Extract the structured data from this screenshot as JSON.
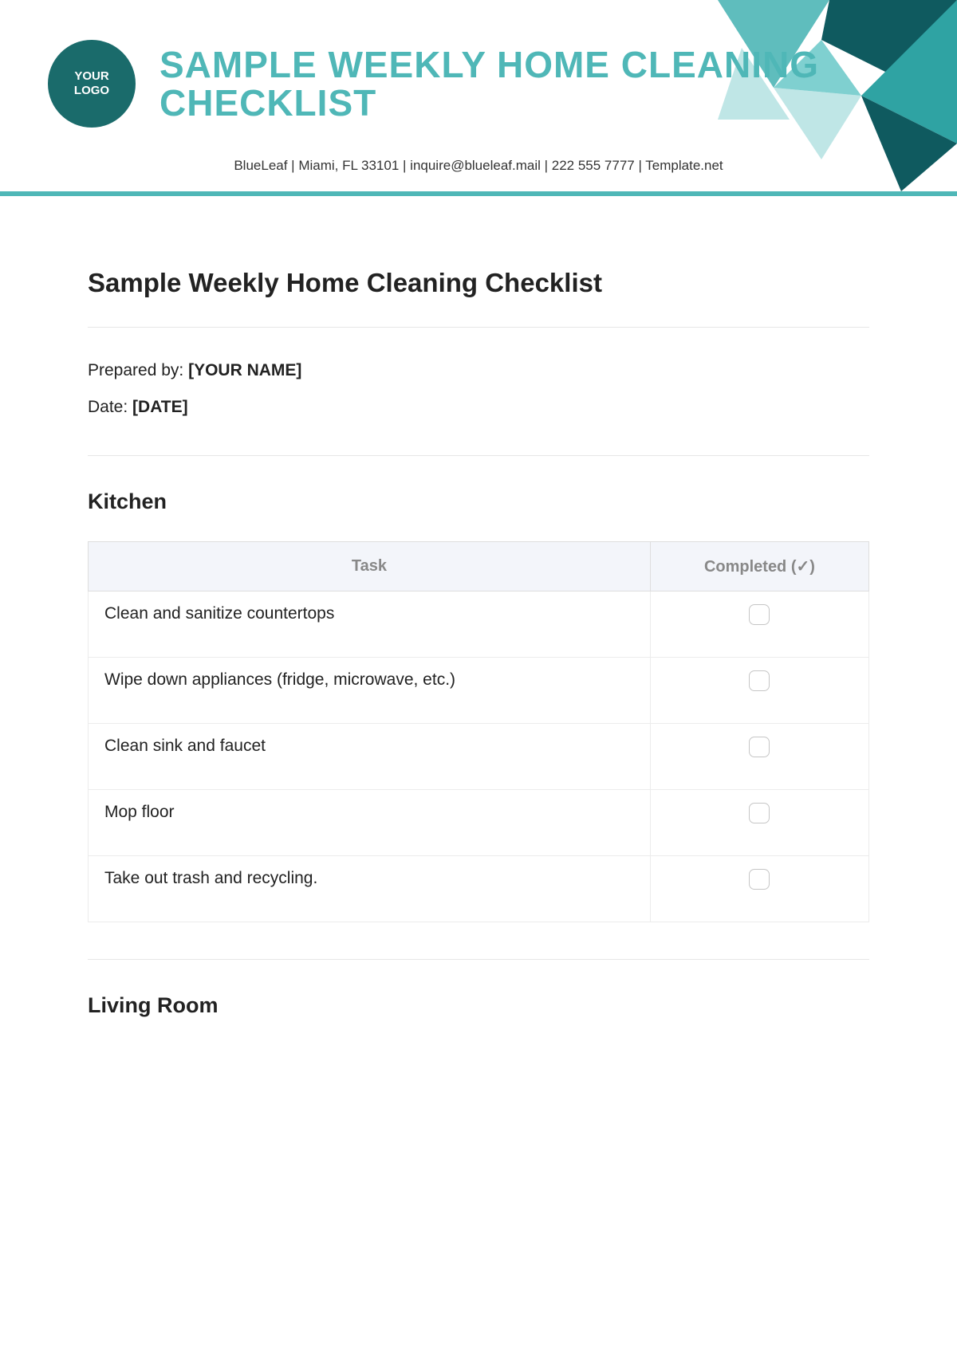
{
  "logo": {
    "line1": "YOUR",
    "line2": "LOGO"
  },
  "header_title": "SAMPLE WEEKLY HOME CLEANING CHECKLIST",
  "contact": "BlueLeaf  |  Miami, FL 33101  |  inquire@blueleaf.mail | 222 555 7777 | Template.net",
  "doc_title": "Sample Weekly Home Cleaning Checklist",
  "meta": {
    "prepared_by_label": "Prepared by: ",
    "prepared_by_value": "[YOUR NAME]",
    "date_label": "Date: ",
    "date_value": "[DATE]"
  },
  "table_headers": {
    "task": "Task",
    "completed": "Completed (✓)"
  },
  "sections": [
    {
      "title": "Kitchen",
      "tasks": [
        "Clean and sanitize countertops",
        "Wipe down appliances (fridge, microwave, etc.)",
        "Clean sink and faucet",
        "Mop floor",
        "Take out trash and recycling."
      ]
    },
    {
      "title": "Living Room",
      "tasks": []
    }
  ],
  "colors": {
    "accent": "#4fb7b7",
    "dark": "#1a6b6b"
  }
}
